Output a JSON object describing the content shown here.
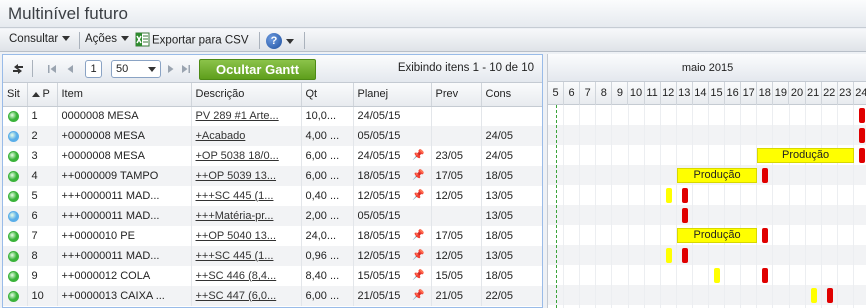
{
  "window": {
    "title": "Multinível futuro"
  },
  "toolbar": {
    "consultar": "Consultar",
    "acoes": "Ações",
    "exportar": "Exportar para CSV",
    "help": "?"
  },
  "pager": {
    "page": "1",
    "page_size": "50",
    "gantt_button": "Ocultar Gantt",
    "info": "Exibindo itens 1 - 10 de 10"
  },
  "columns": {
    "sit": "Sit",
    "p": "P",
    "item": "Item",
    "descricao": "Descrição",
    "qt": "Qt",
    "planej": "Planej",
    "prev": "Prev",
    "cons": "Cons"
  },
  "colors": {
    "status_green": "#3bb33b",
    "status_blue": "#5aaee8",
    "gantt_yellow": "#ffff00",
    "gantt_red": "#e00000",
    "accent_green": "#6fae2a"
  },
  "rows": [
    {
      "status": "green",
      "p": "1",
      "item": "0000008 MESA",
      "desc": "PV 289 #1 Arte...",
      "qt": "10,0...",
      "planej": "24/05/15",
      "pin": false,
      "prev": "",
      "cons": ""
    },
    {
      "status": "blue",
      "p": "2",
      "item": "+0000008 MESA",
      "desc": "+Acabado",
      "qt": "4,00 ...",
      "planej": "05/05/15",
      "pin": false,
      "prev": "",
      "cons": "24/05"
    },
    {
      "status": "green",
      "p": "3",
      "item": "+0000008 MESA",
      "desc": "+OP 5038 18/0...",
      "qt": "6,00 ...",
      "planej": "24/05/15",
      "pin": true,
      "prev": "23/05",
      "cons": "24/05"
    },
    {
      "status": "green",
      "p": "4",
      "item": "++0000009 TAMPO",
      "desc": "++OP 5039 13...",
      "qt": "6,00 ...",
      "planej": "18/05/15",
      "pin": true,
      "prev": "17/05",
      "cons": "18/05"
    },
    {
      "status": "green",
      "p": "5",
      "item": "+++0000011 MAD...",
      "desc": "+++SC 445 (1...",
      "qt": "0,40 ...",
      "planej": "12/05/15",
      "pin": true,
      "prev": "12/05",
      "cons": "13/05"
    },
    {
      "status": "blue",
      "p": "6",
      "item": "+++0000011 MAD...",
      "desc": "+++Matéria-pr...",
      "qt": "2,00 ...",
      "planej": "05/05/15",
      "pin": false,
      "prev": "",
      "cons": "13/05"
    },
    {
      "status": "green",
      "p": "7",
      "item": "++0000010 PE",
      "desc": "++OP 5040 13...",
      "qt": "24,0...",
      "planej": "18/05/15",
      "pin": true,
      "prev": "17/05",
      "cons": "18/05"
    },
    {
      "status": "green",
      "p": "8",
      "item": "+++0000011 MAD...",
      "desc": "+++SC 445 (1...",
      "qt": "0,96 ...",
      "planej": "12/05/15",
      "pin": true,
      "prev": "12/05",
      "cons": "13/05"
    },
    {
      "status": "green",
      "p": "9",
      "item": "++0000012 COLA",
      "desc": "++SC 446 (8,4...",
      "qt": "8,40 ...",
      "planej": "15/05/15",
      "pin": true,
      "prev": "15/05",
      "cons": "18/05"
    },
    {
      "status": "green",
      "p": "10",
      "item": "++0000013 CAIXA ...",
      "desc": "++SC 447 (6,0...",
      "qt": "6,00 ...",
      "planej": "21/05/15",
      "pin": true,
      "prev": "21/05",
      "cons": "22/05"
    }
  ],
  "gantt": {
    "month": "maio 2015",
    "days": [
      "5",
      "6",
      "7",
      "8",
      "9",
      "10",
      "11",
      "12",
      "13",
      "14",
      "15",
      "16",
      "17",
      "18",
      "19",
      "20",
      "21",
      "22",
      "23",
      "24"
    ],
    "bar_label": "Produção",
    "bars": [
      {
        "row": 0,
        "type": "red",
        "day": "24"
      },
      {
        "row": 1,
        "type": "red",
        "day": "24"
      },
      {
        "row": 2,
        "type": "prod",
        "from": "18",
        "to": "23"
      },
      {
        "row": 2,
        "type": "red",
        "day": "24"
      },
      {
        "row": 3,
        "type": "prod",
        "from": "13",
        "to": "17"
      },
      {
        "row": 3,
        "type": "red",
        "day": "18"
      },
      {
        "row": 4,
        "type": "yel",
        "day": "12"
      },
      {
        "row": 4,
        "type": "red",
        "day": "13"
      },
      {
        "row": 5,
        "type": "red",
        "day": "13"
      },
      {
        "row": 6,
        "type": "prod",
        "from": "13",
        "to": "17"
      },
      {
        "row": 6,
        "type": "red",
        "day": "18"
      },
      {
        "row": 7,
        "type": "yel",
        "day": "12"
      },
      {
        "row": 7,
        "type": "red",
        "day": "13"
      },
      {
        "row": 8,
        "type": "yel",
        "day": "15"
      },
      {
        "row": 8,
        "type": "red",
        "day": "18"
      },
      {
        "row": 9,
        "type": "yel",
        "day": "21"
      },
      {
        "row": 9,
        "type": "red",
        "day": "22"
      }
    ]
  }
}
